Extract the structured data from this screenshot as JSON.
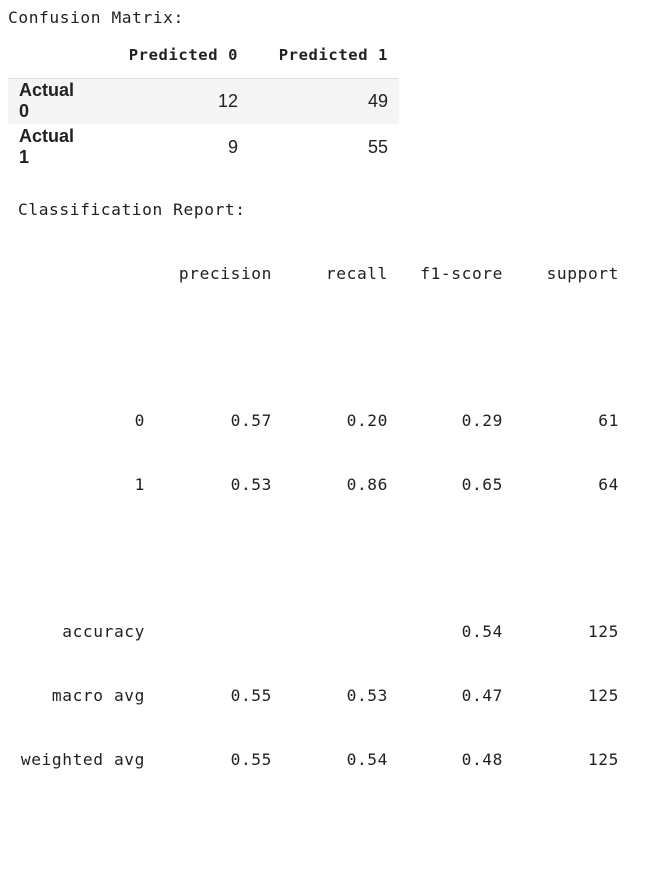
{
  "confusion_matrix": {
    "title": "Confusion Matrix:",
    "columns": [
      "Predicted 0",
      "Predicted 1"
    ],
    "rows": [
      {
        "label": "Actual 0",
        "values": [
          "12",
          "49"
        ]
      },
      {
        "label": "Actual 1",
        "values": [
          "9",
          "55"
        ]
      }
    ]
  },
  "classification_report": {
    "title": "Classification Report:",
    "headers": [
      "precision",
      "recall",
      "f1-score",
      "support"
    ],
    "class_rows": [
      {
        "label": "0",
        "precision": "0.57",
        "recall": "0.20",
        "f1": "0.29",
        "support": "61"
      },
      {
        "label": "1",
        "precision": "0.53",
        "recall": "0.86",
        "f1": "0.65",
        "support": "64"
      }
    ],
    "summary_rows": [
      {
        "label": "accuracy",
        "precision": "",
        "recall": "",
        "f1": "0.54",
        "support": "125"
      },
      {
        "label": "macro avg",
        "precision": "0.55",
        "recall": "0.53",
        "f1": "0.47",
        "support": "125"
      },
      {
        "label": "weighted avg",
        "precision": "0.55",
        "recall": "0.54",
        "f1": "0.48",
        "support": "125"
      }
    ]
  }
}
